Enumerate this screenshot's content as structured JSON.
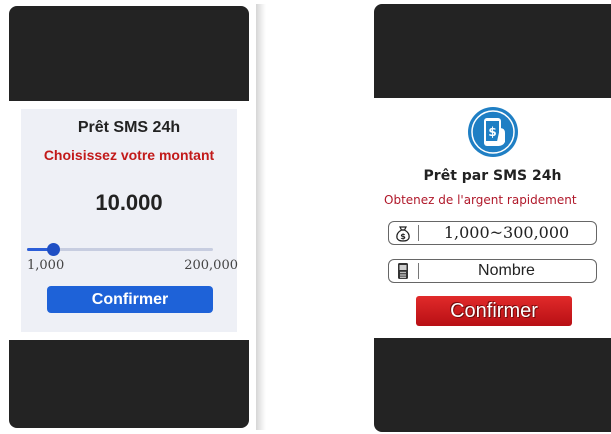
{
  "left_panel": {
    "title": "Prêt SMS 24h",
    "subtitle": "Choisissez votre montant",
    "amount": "10.000",
    "slider": {
      "min_label": "1,000",
      "max_label": "200,000",
      "value_fraction": 0.045
    },
    "confirm_label": "Confirmer",
    "colors": {
      "accent": "#1e62d8",
      "subtitle": "#c21a1a"
    }
  },
  "right_panel": {
    "app_icon": "phone-dollar-icon",
    "title": "Prêt par SMS 24h",
    "subtitle": "Obtenez de l'argent rapidement",
    "amount_field": {
      "icon": "money-bag-icon",
      "value": "1,000~300,000"
    },
    "number_field": {
      "icon": "phone-icon",
      "placeholder": "Nombre"
    },
    "confirm_label": "Confirmer",
    "colors": {
      "button": "#c8181c",
      "icon": "#1f7fc4"
    }
  }
}
